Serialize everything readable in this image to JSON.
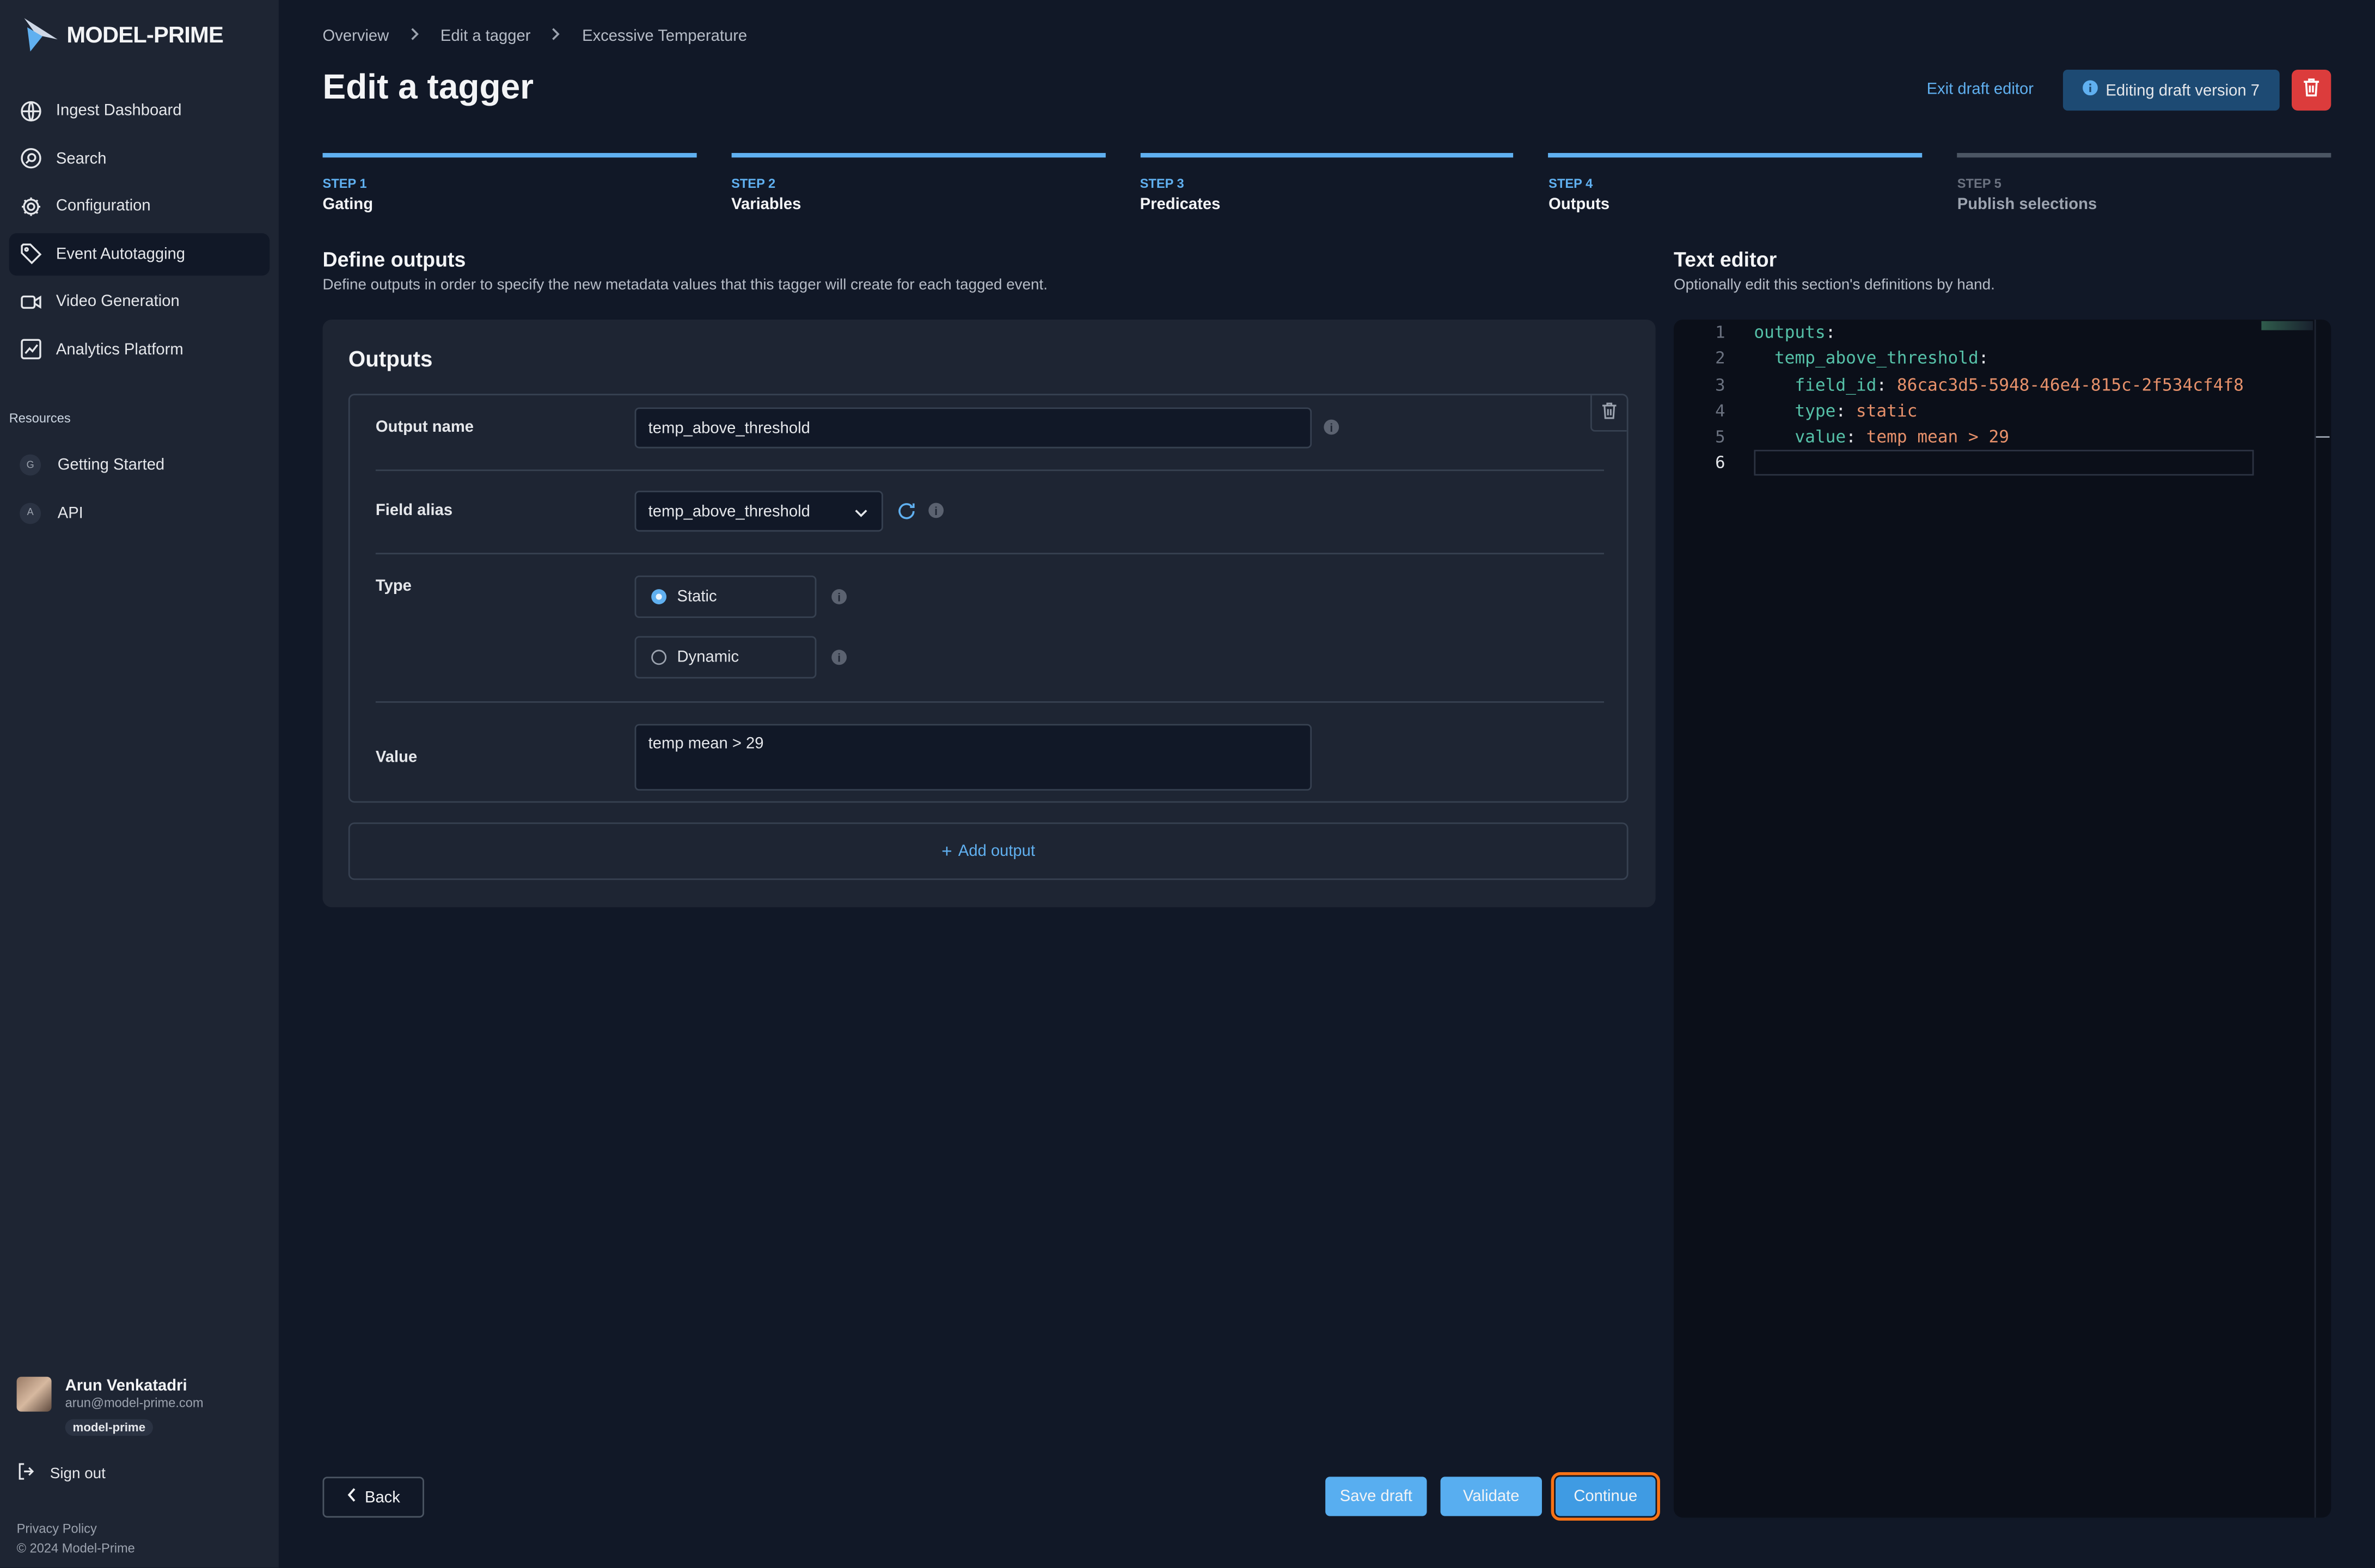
{
  "brand": {
    "name": "MODEL-PRIME"
  },
  "sidebar": {
    "nav": [
      {
        "label": "Ingest Dashboard",
        "icon": "globe-icon"
      },
      {
        "label": "Search",
        "icon": "search-icon"
      },
      {
        "label": "Configuration",
        "icon": "gear-icon"
      },
      {
        "label": "Event Autotagging",
        "icon": "tag-icon",
        "active": true
      },
      {
        "label": "Video Generation",
        "icon": "video-icon"
      },
      {
        "label": "Analytics Platform",
        "icon": "chart-icon"
      }
    ],
    "resources_label": "Resources",
    "resources": [
      {
        "badge": "G",
        "label": "Getting Started"
      },
      {
        "badge": "A",
        "label": "API"
      }
    ],
    "user": {
      "name": "Arun Venkatadri",
      "email": "arun@model-prime.com",
      "org": "model-prime"
    },
    "signout": "Sign out",
    "privacy": "Privacy Policy",
    "copyright": "© 2024 Model-Prime"
  },
  "header": {
    "breadcrumb": [
      "Overview",
      "Edit a tagger",
      "Excessive Temperature"
    ],
    "title": "Edit a tagger",
    "exit_draft": "Exit draft editor",
    "draft_badge": "Editing draft version 7"
  },
  "steps": [
    {
      "num": "STEP 1",
      "name": "Gating",
      "state": "done"
    },
    {
      "num": "STEP 2",
      "name": "Variables",
      "state": "done"
    },
    {
      "num": "STEP 3",
      "name": "Predicates",
      "state": "done"
    },
    {
      "num": "STEP 4",
      "name": "Outputs",
      "state": "current"
    },
    {
      "num": "STEP 5",
      "name": "Publish selections",
      "state": "todo"
    }
  ],
  "define": {
    "title": "Define outputs",
    "desc": "Define outputs in order to specify the new metadata values that this tagger will create for each tagged event."
  },
  "outputs": {
    "title": "Outputs",
    "output_name_label": "Output name",
    "output_name_value": "temp_above_threshold",
    "field_alias_label": "Field alias",
    "field_alias_value": "temp_above_threshold",
    "type_label": "Type",
    "type_static": "Static",
    "type_dynamic": "Dynamic",
    "type_selected": "Static",
    "value_label": "Value",
    "value_text": "temp mean > 29",
    "add_output": "Add output"
  },
  "editor": {
    "title": "Text editor",
    "desc": "Optionally edit this section's definitions by hand.",
    "line_numbers": [
      "1",
      "2",
      "3",
      "4",
      "5",
      "6"
    ],
    "lines": {
      "l1_key": "outputs",
      "l2_key": "temp_above_threshold",
      "l3_key": "field_id",
      "l3_val": "86cac3d5-5948-46e4-815c-2f534cf4f8",
      "l4_key": "type",
      "l4_val": "static",
      "l5_key": "value",
      "l5_val": "temp mean > 29"
    }
  },
  "footer": {
    "back": "Back",
    "save_draft": "Save draft",
    "validate": "Validate",
    "continue": "Continue"
  },
  "colors": {
    "accent": "#60b0f0",
    "danger": "#dc3c3c",
    "focus": "#f97316"
  }
}
